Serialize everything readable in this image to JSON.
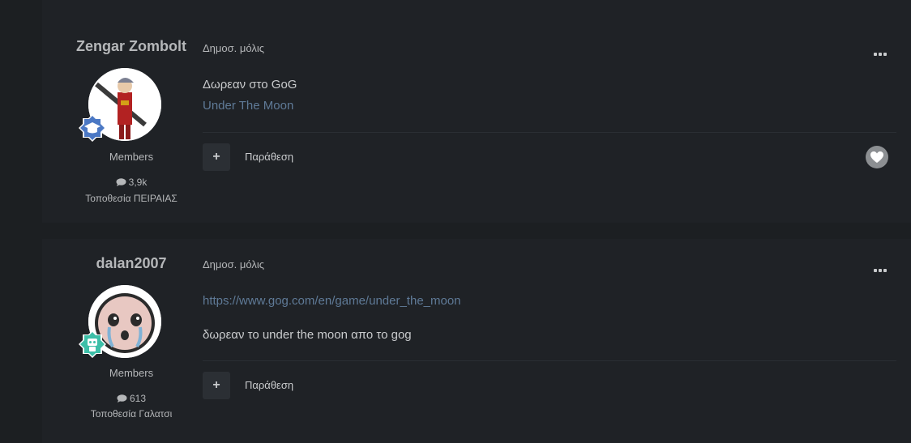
{
  "posts": [
    {
      "author": "Zengar Zombolt",
      "role": "Members",
      "post_count": "3,9k",
      "location": "Τοποθεσία ΠΕΙΡΑΙΑΣ",
      "meta": "Δημοσ. μόλις",
      "text": "Δωρεαν στο GoG",
      "link": "Under The Moon",
      "quote_label": "Παράθεση",
      "plus": "+"
    },
    {
      "author": "dalan2007",
      "role": "Members",
      "post_count": "613",
      "location": "Τοποθεσία Γαλατσι",
      "meta": "Δημοσ. μόλις",
      "link": "https://www.gog.com/en/game/under_the_moon",
      "text": "δωρεαν το under the moon απο το gog",
      "quote_label": "Παράθεση",
      "plus": "+"
    }
  ],
  "icons": {
    "menu": "more-options-icon",
    "comment": "comment-icon",
    "heart": "heart-icon",
    "badge1": "graduate-cap-badge-icon",
    "badge2": "robot-badge-icon"
  }
}
